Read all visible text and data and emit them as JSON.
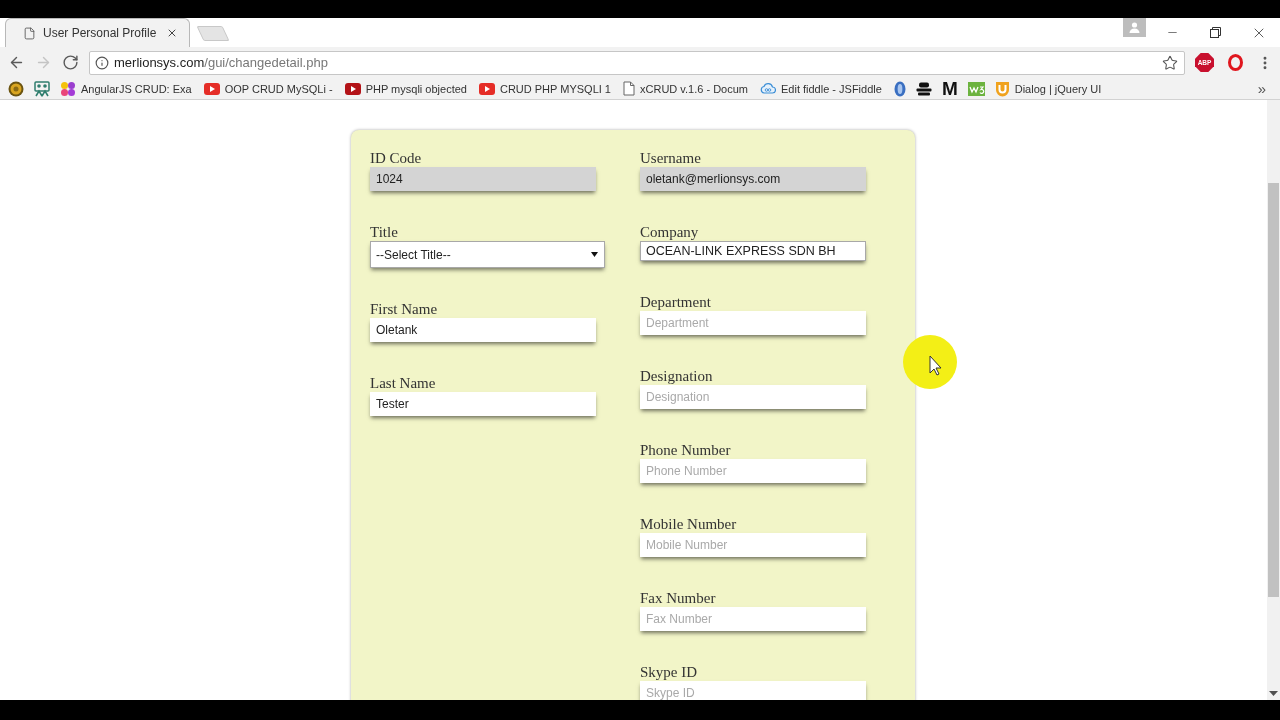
{
  "tabs": [
    {
      "title": "User Personal Profile",
      "selected": true
    }
  ],
  "toolbar": {
    "nav_buttons": [
      {
        "kind": "back",
        "disabled": false
      },
      {
        "kind": "forward",
        "disabled": true
      },
      {
        "kind": "reload",
        "disabled": false
      }
    ],
    "address": {
      "host": "merlionsys.com",
      "path": "/gui/changedetail.php",
      "bookmarked": false
    },
    "extensions": [
      {
        "kind": "badge",
        "label": "ABP"
      },
      {
        "kind": "logo"
      }
    ]
  },
  "bookmarks": {
    "items": [
      {
        "kind": "icon"
      },
      {
        "kind": "icon"
      },
      {
        "kind": "link",
        "label": "AngularJS CRUD: Exa"
      },
      {
        "kind": "link",
        "label": "OOP CRUD MySQLi -"
      },
      {
        "kind": "link",
        "label": "PHP mysqli objected"
      },
      {
        "kind": "link",
        "label": "CRUD PHP MYSQLI 1"
      },
      {
        "kind": "link",
        "label": "xCRUD v.1.6 - Docum"
      },
      {
        "kind": "link",
        "label": "Edit fiddle - JSFiddle"
      },
      {
        "kind": "icon"
      },
      {
        "kind": "icon"
      },
      {
        "kind": "glyph",
        "label": "M"
      },
      {
        "kind": "icon"
      },
      {
        "kind": "link",
        "label": "Dialog | jQuery UI"
      }
    ],
    "overflow": "»"
  },
  "form": {
    "columns": [
      {
        "fields": [
          {
            "label": "ID Code",
            "kind": "text",
            "value": "1024",
            "readonly": true
          },
          {
            "label": "Title",
            "kind": "select",
            "value": "--Select Title--",
            "readonly": false
          },
          {
            "label": "First Name",
            "kind": "text",
            "value": "Oletank",
            "readonly": false
          },
          {
            "label": "Last Name",
            "kind": "text",
            "value": "Tester",
            "readonly": false
          }
        ]
      },
      {
        "fields": [
          {
            "label": "Username",
            "kind": "text",
            "value": "oletank@merlionsys.com",
            "readonly": true
          },
          {
            "label": "Company",
            "kind": "boxed",
            "value": "OCEAN-LINK EXPRESS SDN BH",
            "readonly": false
          },
          {
            "label": "Department",
            "kind": "text",
            "placeholder": "Department",
            "readonly": false
          },
          {
            "label": "Designation",
            "kind": "text",
            "placeholder": "Designation",
            "readonly": false
          },
          {
            "label": "Phone Number",
            "kind": "text",
            "placeholder": "Phone Number",
            "readonly": false
          },
          {
            "label": "Mobile Number",
            "kind": "text",
            "placeholder": "Mobile Number",
            "readonly": false
          },
          {
            "label": "Fax Number",
            "kind": "text",
            "placeholder": "Fax Number",
            "readonly": false
          },
          {
            "label": "Skype ID",
            "kind": "text",
            "placeholder": "Skype ID",
            "readonly": false
          }
        ]
      }
    ]
  }
}
